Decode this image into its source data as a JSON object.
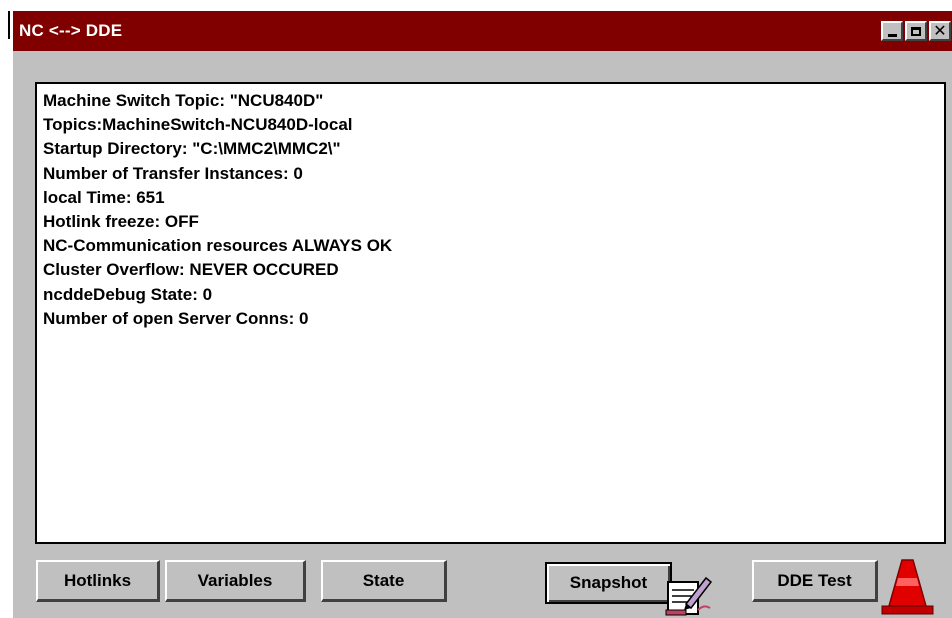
{
  "window": {
    "title": "NC <--> DDE"
  },
  "content": {
    "lines": [
      "Machine Switch Topic: \"NCU840D\"",
      "Topics:MachineSwitch-NCU840D-local",
      "Startup Directory: \"C:\\MMC2\\MMC2\\\"",
      "Number of Transfer Instances: 0",
      "local Time: 651",
      "Hotlink freeze: OFF",
      "NC-Communication resources ALWAYS OK",
      "Cluster Overflow: NEVER OCCURED",
      "ncddeDebug State: 0",
      "Number of open Server Conns: 0"
    ]
  },
  "buttons": {
    "hotlinks": "Hotlinks",
    "variables": "Variables",
    "state": "State",
    "snapshot": "Snapshot",
    "dde_test": "DDE Test"
  },
  "icons": {
    "snapshot": "notepad-pen-icon",
    "dde_test": "traffic-cone-icon"
  },
  "colors": {
    "titlebar": "#800000",
    "window": "#c0c0c0",
    "cone": "#e00000"
  }
}
